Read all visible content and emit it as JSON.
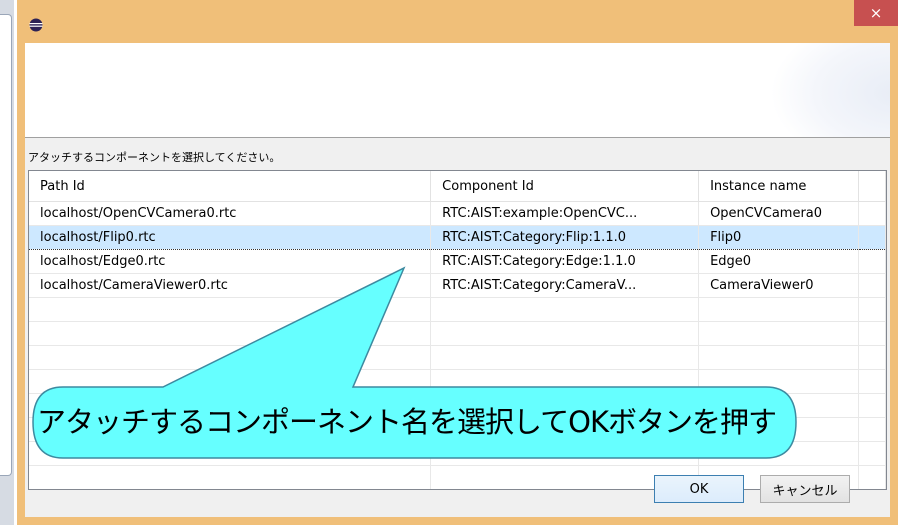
{
  "dialog": {
    "close_symbol": "×",
    "icon": "eclipse-app-icon",
    "prompt": "アタッチするコンポーネントを選択してください。"
  },
  "table": {
    "columns": [
      "Path Id",
      "Component Id",
      "Instance name"
    ],
    "rows": [
      {
        "path": "localhost/OpenCVCamera0.rtc",
        "component": "RTC:AIST:example:OpenCVC...",
        "instance": "OpenCVCamera0",
        "selected": false
      },
      {
        "path": "localhost/Flip0.rtc",
        "component": "RTC:AIST:Category:Flip:1.1.0",
        "instance": "Flip0",
        "selected": true
      },
      {
        "path": "localhost/Edge0.rtc",
        "component": "RTC:AIST:Category:Edge:1.1.0",
        "instance": "Edge0",
        "selected": false
      },
      {
        "path": "localhost/CameraViewer0.rtc",
        "component": "RTC:AIST:Category:CameraV...",
        "instance": "CameraViewer0",
        "selected": false
      }
    ]
  },
  "callout": {
    "text": "アタッチするコンポーネント名を選択してOKボタンを押す",
    "fill": "#66ffff"
  },
  "buttons": {
    "ok": "OK",
    "cancel": "キャンセル"
  },
  "colors": {
    "title_bar": "#f0bf79",
    "close_button": "#c75050",
    "selection": "#cde8ff"
  }
}
